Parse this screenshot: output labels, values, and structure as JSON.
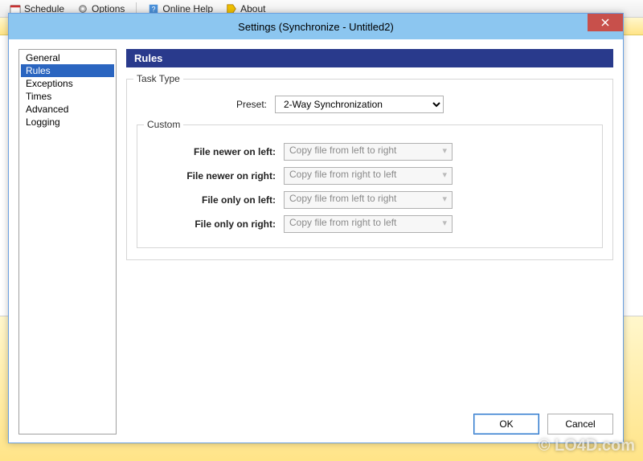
{
  "bg_menu": {
    "schedule": "Schedule",
    "options": "Options",
    "online_help": "Online Help",
    "about": "About"
  },
  "dialog": {
    "title": "Settings (Synchronize - Untitled2)"
  },
  "sidebar": {
    "items": [
      {
        "label": "General"
      },
      {
        "label": "Rules"
      },
      {
        "label": "Exceptions"
      },
      {
        "label": "Times"
      },
      {
        "label": "Advanced"
      },
      {
        "label": "Logging"
      }
    ],
    "selected_index": 1
  },
  "panel": {
    "header": "Rules",
    "task_type_legend": "Task Type",
    "preset_label": "Preset:",
    "preset_value": "2-Way Synchronization",
    "custom_legend": "Custom",
    "rows": [
      {
        "label": "File newer on left:",
        "value": "Copy file from left to right"
      },
      {
        "label": "File newer on right:",
        "value": "Copy file from right to left"
      },
      {
        "label": "File only on left:",
        "value": "Copy file from left to right"
      },
      {
        "label": "File only on right:",
        "value": "Copy file from right to left"
      }
    ]
  },
  "buttons": {
    "ok": "OK",
    "cancel": "Cancel"
  },
  "watermark": "© LO4D.com"
}
